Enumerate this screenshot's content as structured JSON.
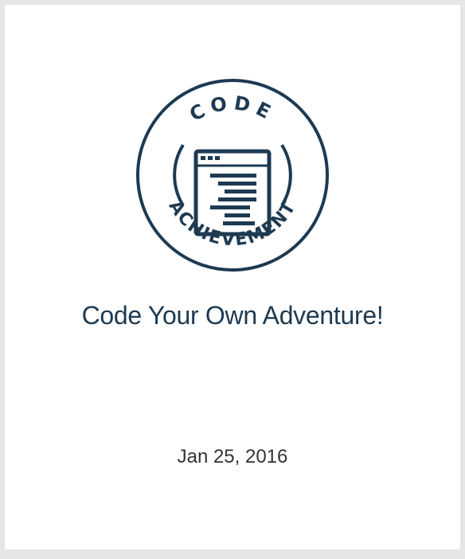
{
  "badge": {
    "top_text": "CODE",
    "bottom_text": "ACHIEVEMENT",
    "icon": "code-window-icon",
    "color": "#1d3a52"
  },
  "achievement": {
    "title": "Code Your Own Adventure!",
    "date": "Jan 25, 2016"
  },
  "colors": {
    "background": "#e6e6e6",
    "card": "#ffffff",
    "title": "#1d3a52",
    "date": "#333333"
  }
}
